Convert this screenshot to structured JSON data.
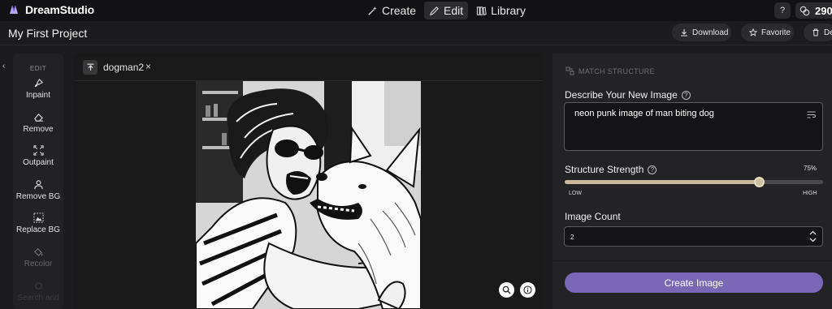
{
  "app": {
    "name": "DreamStudio"
  },
  "nav": {
    "items": [
      {
        "label": "Create",
        "icon": "wand-icon"
      },
      {
        "label": "Edit",
        "icon": "pencil-icon",
        "active": true
      },
      {
        "label": "Library",
        "icon": "library-icon"
      }
    ]
  },
  "header": {
    "help_label": "?",
    "credits": "290"
  },
  "project": {
    "title": "My First Project",
    "actions": {
      "download": "Download",
      "favorite": "Favorite",
      "delete": "Delete"
    }
  },
  "tools": {
    "collapse_glyph": "‹",
    "header": "EDIT",
    "items": [
      {
        "label": "Inpaint",
        "icon": "brush-icon"
      },
      {
        "label": "Remove",
        "icon": "eraser-icon"
      },
      {
        "label": "Outpaint",
        "icon": "expand-icon"
      },
      {
        "label": "Remove BG",
        "icon": "person-icon"
      },
      {
        "label": "Replace BG",
        "icon": "replace-bg-icon"
      },
      {
        "label": "Recolor",
        "icon": "paint-bucket-icon",
        "disabled": true
      },
      {
        "label": "Search and",
        "icon": "search-replace-icon",
        "faded": true
      }
    ]
  },
  "canvas": {
    "tab_name": "dogman2",
    "tab_close": "×"
  },
  "panel": {
    "section": "MATCH STRUCTURE",
    "prompt_label": "Describe Your New Image",
    "prompt_value": "neon punk image of man biting dog",
    "strength_label": "Structure Strength",
    "strength_value": "75%",
    "strength": 0.75,
    "slider_low": "LOW",
    "slider_high": "HIGH",
    "count_label": "Image Count",
    "count_value": "2",
    "create_label": "Create Image"
  },
  "colors": {
    "accent": "#7a67b6",
    "slider_fill": "#c9b99a",
    "background": "#1c1c1e"
  }
}
